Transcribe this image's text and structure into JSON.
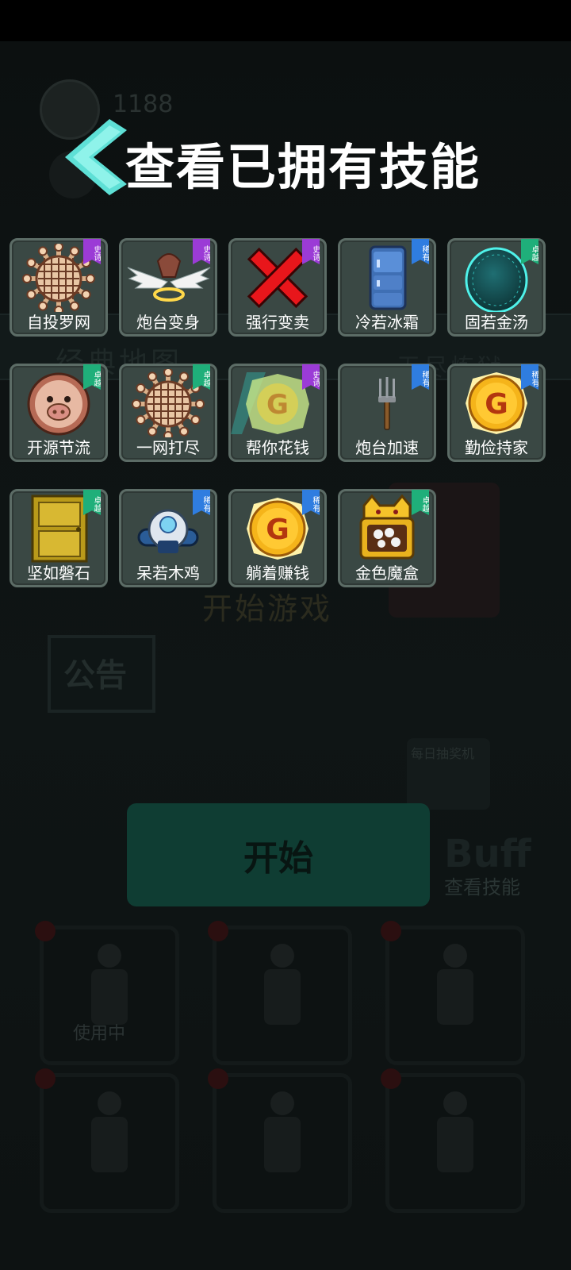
{
  "overlay": {
    "title": "查看已拥有技能",
    "back_icon": "chevron-left-icon"
  },
  "background": {
    "coins": "1188",
    "map_left": "经典地图",
    "map_right": "无尽炼狱",
    "start_game": "开始游戏",
    "notice": "公告",
    "daily": "每日抽奖机",
    "start_button": "开始",
    "buff_logo": "Buff",
    "buff_label": "查看技能",
    "in_use": "使用中"
  },
  "rarity_colors": {
    "epic": "#9b3bd6",
    "rare": "#2f7de0",
    "excellent": "#1faf7a"
  },
  "skills": [
    {
      "name": "自投罗网",
      "rarity": "史诗",
      "tier": "epic",
      "icon": "net-icon"
    },
    {
      "name": "炮台变身",
      "rarity": "史诗",
      "tier": "epic",
      "icon": "winged-turret-icon"
    },
    {
      "name": "强行变卖",
      "rarity": "史诗",
      "tier": "epic",
      "icon": "red-x-icon"
    },
    {
      "name": "冷若冰霜",
      "rarity": "稀有",
      "tier": "rare",
      "icon": "fridge-icon"
    },
    {
      "name": "固若金汤",
      "rarity": "卓越",
      "tier": "excellent",
      "icon": "egg-shield-icon"
    },
    {
      "name": "开源节流",
      "rarity": "卓越",
      "tier": "excellent",
      "icon": "pig-coin-icon"
    },
    {
      "name": "一网打尽",
      "rarity": "卓越",
      "tier": "excellent",
      "icon": "net-icon"
    },
    {
      "name": "帮你花钱",
      "rarity": "史诗",
      "tier": "epic",
      "icon": "ghost-coin-icon"
    },
    {
      "name": "炮台加速",
      "rarity": "稀有",
      "tier": "rare",
      "icon": "fork-icon"
    },
    {
      "name": "勤俭持家",
      "rarity": "稀有",
      "tier": "rare",
      "icon": "gold-coin-icon"
    },
    {
      "name": "坚如磐石",
      "rarity": "卓越",
      "tier": "excellent",
      "icon": "gold-door-icon"
    },
    {
      "name": "呆若木鸡",
      "rarity": "稀有",
      "tier": "rare",
      "icon": "robot-turret-icon"
    },
    {
      "name": "躺着赚钱",
      "rarity": "稀有",
      "tier": "rare",
      "icon": "gold-coin-icon"
    },
    {
      "name": "金色魔盒",
      "rarity": "卓越",
      "tier": "excellent",
      "icon": "treasure-box-icon"
    }
  ]
}
